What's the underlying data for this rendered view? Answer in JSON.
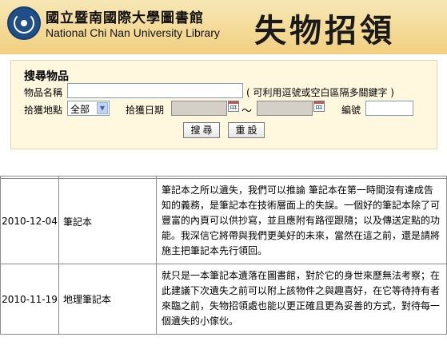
{
  "header": {
    "library_name_zh": "國立暨南國際大學圖書館",
    "library_name_en": "National Chi Nan University  Library",
    "page_title": "失物招領"
  },
  "search": {
    "title": "搜尋物品",
    "item_name_label": "物品名稱",
    "item_name_value": "",
    "item_name_hint": "( 可利用逗號或空白區隔多關鍵字 )",
    "location_label": "拾獲地點",
    "location_selected": "全部",
    "date_label": "拾獲日期",
    "date_from": "",
    "date_to": "",
    "date_separator": "～",
    "id_label": "編號",
    "id_value": "",
    "search_button": "搜尋",
    "reset_button": "重設"
  },
  "items": [
    {
      "date": "2010-12-04",
      "name": "筆記本",
      "description": "筆記本之所以遺失，我們可以推論 筆記本在第一時間沒有達成告知的義務，是筆記本在技術層面上的失誤。一個好的筆記本除了可豐富的內頁可以供抄寫，並且應附有路徑跟隨；以及傳送定點的功能。我深信它將帶與我們更美好的未來，當然在這之前，還是請將施主把筆記本先行領回。"
    },
    {
      "date": "2010-11-19",
      "name": "地理筆記本",
      "description": "就只是一本筆記本遺落在圖書館，對於它的身世來歷無法考察；在此建議下次遺失之前可以附上該物件之與趣喜好，在它等待持有者來臨之前，失物招領處也能以更正確且更為妥善的方式，對待每一個遺失的小傢伙。"
    }
  ]
}
